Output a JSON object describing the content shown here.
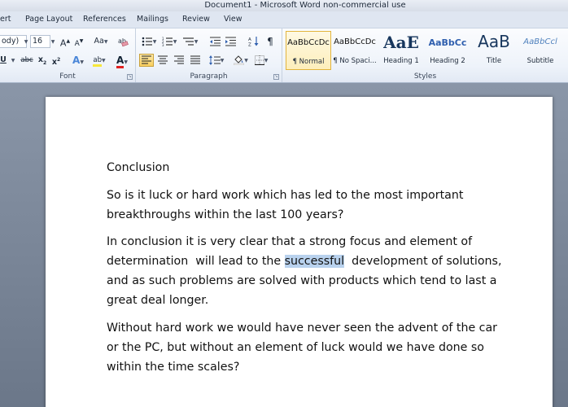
{
  "window": {
    "title": "Document1  -  Microsoft Word non-commercial use"
  },
  "tabs": [
    "ert",
    "Page Layout",
    "References",
    "Mailings",
    "Review",
    "View"
  ],
  "ribbon": {
    "font": {
      "label": "Font",
      "font_name": "ody)",
      "font_size": "16",
      "grow_glyph": "A",
      "shrink_glyph": "A",
      "change_case_glyph": "Aa",
      "underline_glyph": "U",
      "strikethrough_glyph": "abc",
      "subscript_glyph": "x",
      "superscript_glyph": "x",
      "text_effects_glyph": "A",
      "highlight_glyph": "ab",
      "font_color_glyph": "A"
    },
    "paragraph": {
      "label": "Paragraph",
      "show_marks_glyph": "¶"
    },
    "styles": {
      "label": "Styles",
      "items": [
        {
          "sample": "AaBbCcDc",
          "name": "¶ Normal"
        },
        {
          "sample": "AaBbCcDc",
          "name": "¶ No Spaci..."
        },
        {
          "sample": "AaE",
          "name": "Heading 1"
        },
        {
          "sample": "AaBbCc",
          "name": "Heading 2"
        },
        {
          "sample": "AaB",
          "name": "Title"
        },
        {
          "sample": "AaBbCcl",
          "name": "Subtitle"
        }
      ]
    }
  },
  "document": {
    "heading": "Conclusion",
    "p1": [
      "So is it luck or hard work which has led to the most important",
      "breakthroughs  within the last 100 years?"
    ],
    "p2": {
      "line1": "In conclusion it is very clear that a strong focus and element of",
      "line2_before": "determination  will lead to the ",
      "line2_selected": "successful",
      "line2_after": "  development of solutions,",
      "line3": "and as such problems are solved with products which tend to last a",
      "line4": "great deal longer."
    },
    "p3": [
      "Without hard work we would have never seen the advent of the car",
      "or the PC, but without an element of luck would we have done so",
      "within the time scales?"
    ]
  },
  "colors": {
    "selection": "#b9d2ee",
    "heading_blue": "#17365d",
    "accent_blue": "#2e5eae"
  }
}
